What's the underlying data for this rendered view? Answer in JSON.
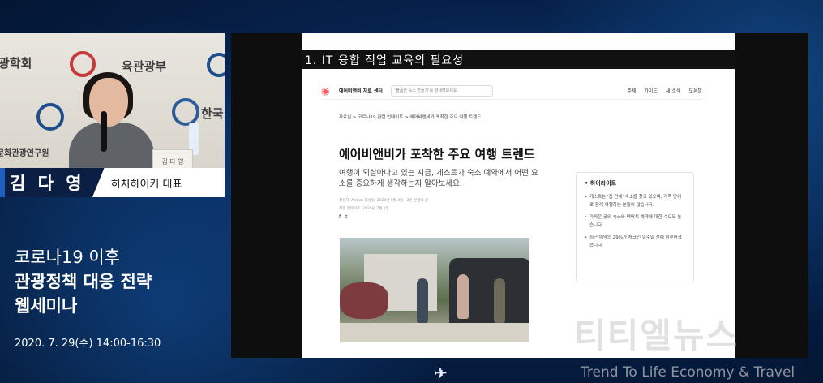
{
  "speaker": {
    "name": "김 다 영",
    "role": "히치하이커 대표",
    "backdrop": {
      "text_left_top": "광학회",
      "text_ministry": "육관광부",
      "text_institute": "문화관광연구원",
      "text_right": "한국",
      "nameplate": "김 다 영"
    }
  },
  "webinar": {
    "title_line1": "코로나19 이후",
    "title_line2": "관광정책 대응 전략",
    "title_line3": "웹세미나",
    "datetime": "2020. 7. 29(수) 14:00-16:30"
  },
  "slide": {
    "heading": "1. IT 융합 직업 교육의 필요성",
    "site": {
      "name": "에어비앤비 자료 센터",
      "search_placeholder": "'볼품한 숙소 만들기'를 검색해보세요.",
      "nav": [
        "주제",
        "가이드",
        "새 소식",
        "도움말"
      ]
    },
    "breadcrumb": "자료실  >  코로나19 관련 업데이트  >  에어비앤비가 포착한 주요 여행 트렌드",
    "article": {
      "title": "에어비앤비가 포착한 주요 여행 트렌드",
      "intro": "여행이 되살아나고 있는 지금, 게스트가 숙소 예약에서 어떤 요소를 중요하게 생각하는지 알아보세요.",
      "meta_line1": "작성자: Airbnb 작성일: 2020년 6월 4일 · 2분 분량의 글",
      "meta_line2": "최종 업데이트: 2020년 7월 1일",
      "share": [
        "f",
        "t"
      ]
    },
    "highlights": {
      "title": "하이라이트",
      "items": [
        "게스트는 '집 전체' 숙소를 찾고 있으며, 가족 단위로 함께 여행하는 분들이 많습니다.",
        "가까운 곳의 숙소와 펙버치 예약에 대한 수요도 높습니다.",
        "최근 예약의 29%가 체크인 일주일 전에 이루어졌습니다."
      ]
    }
  },
  "watermark": {
    "brand": "티티엘뉴스",
    "tagline": "Trend To Life Economy & Travel"
  },
  "colors": {
    "accent_blue": "#1e5fc2",
    "name_bar_dark": "#0b1e44",
    "airbnb": "#ff5a5f"
  },
  "icons": {
    "airbnb_logo": "airbnb-icon",
    "plane": "airplane-icon"
  }
}
